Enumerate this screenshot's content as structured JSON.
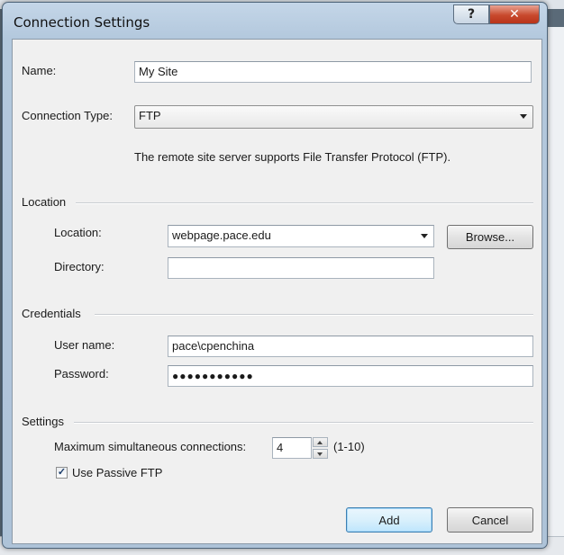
{
  "window": {
    "title": "Connection Settings",
    "help_label": "?",
    "close_label": "✕"
  },
  "name": {
    "label": "Name:",
    "value": "My Site"
  },
  "connection_type": {
    "label": "Connection Type:",
    "value": "FTP",
    "description": "The remote site server supports File Transfer Protocol (FTP)."
  },
  "location_group": {
    "title": "Location",
    "location_label": "Location:",
    "location_value": "webpage.pace.edu",
    "browse_label": "Browse...",
    "directory_label": "Directory:",
    "directory_value": ""
  },
  "credentials_group": {
    "title": "Credentials",
    "username_label": "User name:",
    "username_value": "pace\\cpenchina",
    "password_label": "Password:",
    "password_mask": "●●●●●●●●●●●"
  },
  "settings_group": {
    "title": "Settings",
    "max_connections_label": "Maximum simultaneous connections:",
    "max_connections_value": "4",
    "max_connections_range": "(1-10)",
    "passive_ftp_label": "Use Passive FTP",
    "passive_ftp_checked": true,
    "checkmark": "✓"
  },
  "buttons": {
    "add_label": "Add",
    "cancel_label": "Cancel"
  },
  "icons": [
    "help-icon",
    "close-icon",
    "dropdown-arrow-icon",
    "spin-up-icon",
    "spin-down-icon",
    "checkmark-icon"
  ]
}
